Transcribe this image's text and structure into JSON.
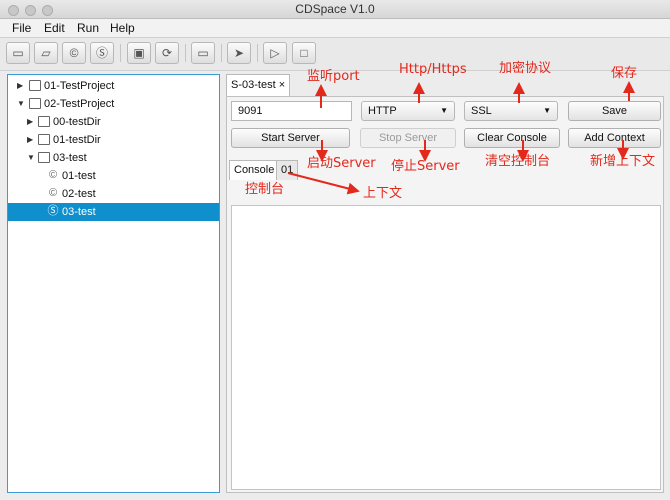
{
  "window": {
    "title": "CDSpace V1.0"
  },
  "menu": [
    "File",
    "Edit",
    "Run",
    "Help"
  ],
  "toolbar": {
    "icons": [
      "new-window-icon",
      "open-folder-icon",
      "copyright-icon",
      "s-circle-icon",
      "save-icon",
      "refresh-icon",
      "folder-icon",
      "send-icon",
      "play-icon",
      "stop-icon"
    ],
    "glyphs": [
      "▭",
      "▱",
      "©",
      "Ⓢ",
      "▣",
      "⟳",
      "▭",
      "➤",
      "▷",
      "□"
    ]
  },
  "tree": [
    {
      "label": "01-TestProject",
      "level": 0,
      "expanded": false,
      "icon": "project-icon"
    },
    {
      "label": "02-TestProject",
      "level": 0,
      "expanded": true,
      "icon": "project-icon"
    },
    {
      "label": "00-testDir",
      "level": 1,
      "expanded": false,
      "icon": "folder-icon"
    },
    {
      "label": "01-testDir",
      "level": 1,
      "expanded": false,
      "icon": "folder-icon"
    },
    {
      "label": "03-test",
      "level": 1,
      "expanded": true,
      "icon": "folder-icon"
    },
    {
      "label": "01-test",
      "level": 2,
      "icon": "copyright-icon",
      "glyph": "©"
    },
    {
      "label": "02-test",
      "level": 2,
      "icon": "copyright-icon",
      "glyph": "©"
    },
    {
      "label": "03-test",
      "level": 2,
      "icon": "s-circle-icon",
      "glyph": "Ⓢ",
      "selected": true
    }
  ],
  "main": {
    "tab_label": "S-03-test",
    "tab_close": "×",
    "port_value": "9091",
    "protocol_selected": "HTTP",
    "ssl_selected": "SSL",
    "save_label": "Save",
    "start_label": "Start Server",
    "stop_label": "Stop Server",
    "clear_label": "Clear Console",
    "add_context_label": "Add Context",
    "subtabs": [
      "Console",
      "01"
    ]
  },
  "annotations": {
    "port": "监听port",
    "http": "Http/Https",
    "encrypt": "加密协议",
    "save": "保存",
    "start": "启动Server",
    "stop": "停止Server",
    "clear": "清空控制台",
    "add": "新增上下文",
    "console": "控制台",
    "context": "上下文"
  },
  "colors": {
    "annotation": "#e3281c",
    "selection": "#0f8fcc",
    "focus_border": "#3b99d4"
  }
}
